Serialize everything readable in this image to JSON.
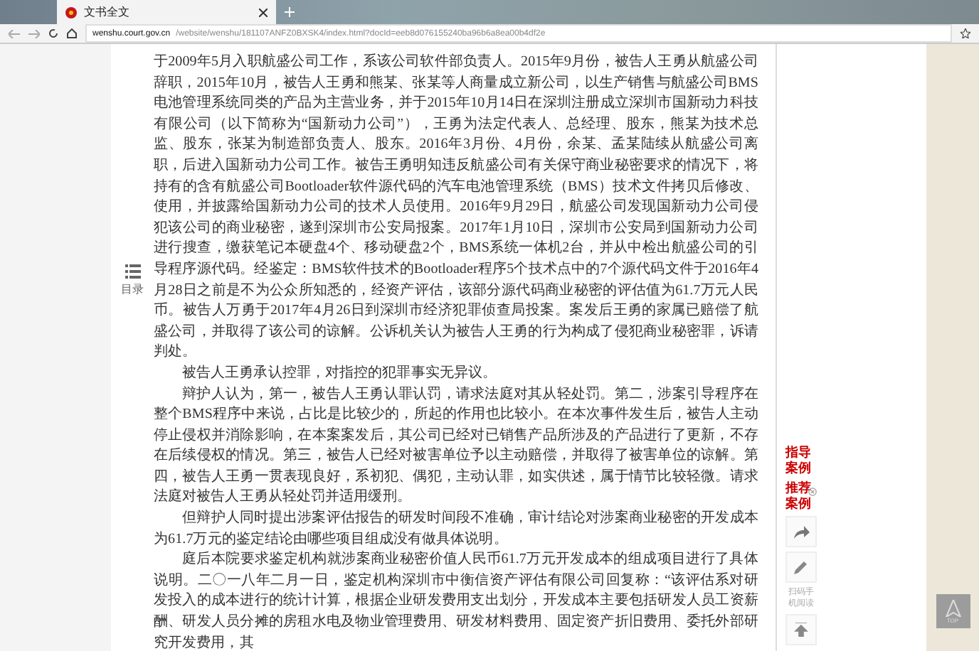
{
  "browser": {
    "tab": {
      "title": "文书全文",
      "selected": true
    },
    "url": {
      "host": "wenshu.court.gov.cn",
      "path": "/website/wenshu/181107ANFZ0BXSK4/index.html?docId=eeb8d076155240ba96b6a8ea00b4df2e"
    }
  },
  "toc": {
    "label": "目录"
  },
  "paragraphs": [
    {
      "indent": false,
      "text": "于2009年5月入职航盛公司工作，系该公司软件部负责人。2015年9月份，被告人王勇从航盛公司辞职，2015年10月，被告人王勇和熊某、张某等人商量成立新公司，以生产销售与航盛公司BMS电池管理系统同类的产品为主营业务，并于2015年10月14日在深圳注册成立深圳市国新动力科技有限公司（以下简称为“国新动力公司”），王勇为法定代表人、总经理、股东，熊某为技术总监、股东，张某为制造部负责人、股东。2016年3月份、4月份，余某、孟某陆续从航盛公司离职，后进入国新动力公司工作。被告王勇明知违反航盛公司有关保守商业秘密要求的情况下，将持有的含有航盛公司Bootloader软件源代码的汽车电池管理系统（BMS）技术文件拷贝后修改、使用，并披露给国新动力公司的技术人员使用。2016年9月29日，航盛公司发现国新动力公司侵犯该公司的商业秘密，遂到深圳市公安局报案。2017年1月10日，深圳市公安局到国新动力公司进行搜查，缴获笔记本硬盘4个、移动硬盘2个，BMS系统一体机2台，并从中检出航盛公司的引导程序源代码。经鉴定：BMS软件技术的Bootloader程序5个技术点中的7个源代码文件于2016年4月28日之前是不为公众所知悉的，经资产评估，该部分源代码商业秘密的评估值为61.7万元人民币。被告人万勇于2017年4月26日到深圳市经济犯罪侦查局投案。案发后王勇的家属已赔偿了航盛公司，并取得了该公司的谅解。公诉机关认为被告人王勇的行为构成了侵犯商业秘密罪，诉请判处。"
    },
    {
      "indent": true,
      "text": "被告人王勇承认控罪，对指控的犯罪事实无异议。"
    },
    {
      "indent": true,
      "text": "辩护人认为，第一，被告人王勇认罪认罚，请求法庭对其从轻处罚。第二，涉案引导程序在整个BMS程序中来说，占比是比较少的，所起的作用也比较小。在本次事件发生后，被告人主动停止侵权并消除影响，在本案案发后，其公司已经对已销售产品所涉及的产品进行了更新，不存在后续侵权的情况。第三，被告人已经对被害单位予以主动赔偿，并取得了被害单位的谅解。第四，被告人王勇一贯表现良好，系初犯、偶犯，主动认罪，如实供述，属于情节比较轻微。请求法庭对被告人王勇从轻处罚并适用缓刑。"
    },
    {
      "indent": true,
      "text": "但辩护人同时提出涉案评估报告的研发时间段不准确，审计结论对涉案商业秘密的开发成本为61.7万元的鉴定结论由哪些项目组成没有做具体说明。"
    },
    {
      "indent": true,
      "text": "庭后本院要求鉴定机构就涉案商业秘密价值人民币61.7万元开发成本的组成项目进行了具体说明。二〇一八年二月一日，鉴定机构深圳市中衡信资产评估有限公司回复称：“该评估系对研发投入的成本进行的统计计算，根据企业研发费用支出划分，开发成本主要包括研发人员工资薪酬、研发人员分摊的房租水电及物业管理费用、研发材料费用、固定资产折旧费用、委托外部研究开发费用，其"
    }
  ],
  "sidebar": {
    "links": [
      "指导案例",
      "推荐案例"
    ],
    "qr_label": "扫码手机阅读"
  },
  "top_button": {
    "label": "TOP"
  }
}
